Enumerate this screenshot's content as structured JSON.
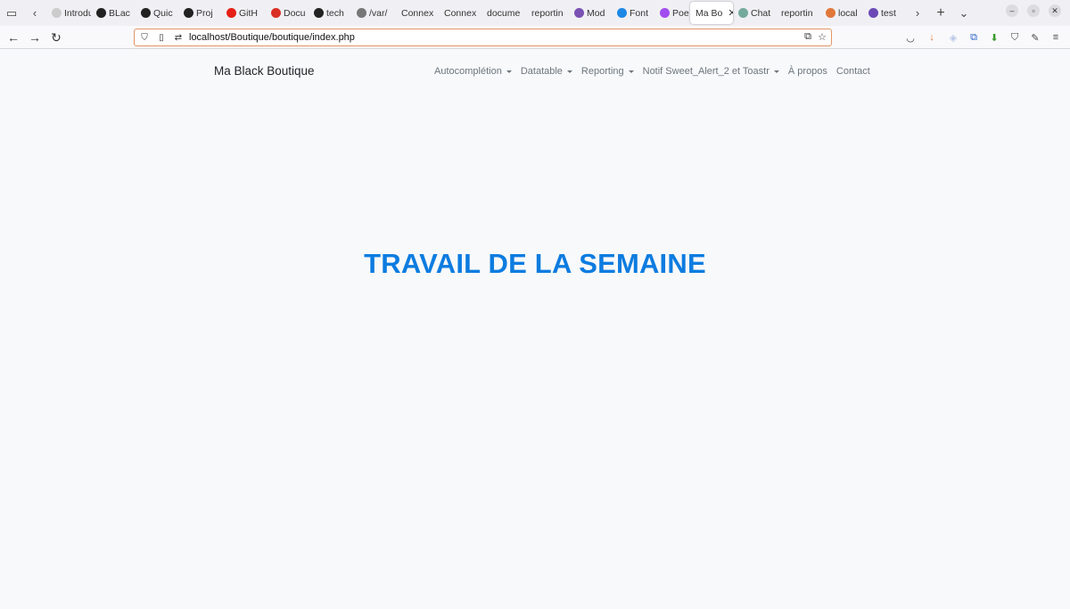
{
  "browser": {
    "tabs": [
      {
        "label": "Introdu",
        "icon": "document-icon",
        "color": "#cccccc"
      },
      {
        "label": "BLac",
        "icon": "github-icon",
        "color": "#222222"
      },
      {
        "label": "Quic",
        "icon": "github-icon",
        "color": "#222222"
      },
      {
        "label": "Proj",
        "icon": "github-icon",
        "color": "#222222"
      },
      {
        "label": "GitH",
        "icon": "youtube-icon",
        "color": "#e62117"
      },
      {
        "label": "Docu",
        "icon": "pdf-icon",
        "color": "#d93025"
      },
      {
        "label": "tech",
        "icon": "github-icon",
        "color": "#222222"
      },
      {
        "label": "/var/",
        "icon": "info-icon",
        "color": "#777777"
      },
      {
        "label": "Connex",
        "icon": "none",
        "color": ""
      },
      {
        "label": "Connex",
        "icon": "none",
        "color": ""
      },
      {
        "label": "docume",
        "icon": "none",
        "color": ""
      },
      {
        "label": "reportin",
        "icon": "none",
        "color": ""
      },
      {
        "label": "Mod",
        "icon": "bootstrap-icon",
        "color": "#7952b3"
      },
      {
        "label": "Font",
        "icon": "flag-icon",
        "color": "#1e88e5"
      },
      {
        "label": "Poe",
        "icon": "poe-icon",
        "color": "#a24df0"
      },
      {
        "label": "Ma Bo",
        "icon": "none",
        "color": "",
        "active": true
      },
      {
        "label": "Chat",
        "icon": "chatgpt-icon",
        "color": "#74aa9c"
      },
      {
        "label": "reportin",
        "icon": "none",
        "color": ""
      },
      {
        "label": "local",
        "icon": "mountain-icon",
        "color": "#e2773a"
      },
      {
        "label": "test",
        "icon": "e-icon",
        "color": "#6c4ab6"
      }
    ],
    "url": "localhost/Boutique/boutique/index.php"
  },
  "page": {
    "brand": "Ma Black Boutique",
    "menu": [
      {
        "label": "Autocomplétion",
        "dropdown": true
      },
      {
        "label": "Datatable",
        "dropdown": true
      },
      {
        "label": "Reporting",
        "dropdown": true
      },
      {
        "label": "Notif Sweet_Alert_2 et Toastr",
        "dropdown": true
      },
      {
        "label": "À propos",
        "dropdown": false
      },
      {
        "label": "Contact",
        "dropdown": false
      }
    ],
    "hero_title": "TRAVAIL DE LA SEMAINE",
    "hero_color": "#0d7ce0"
  }
}
